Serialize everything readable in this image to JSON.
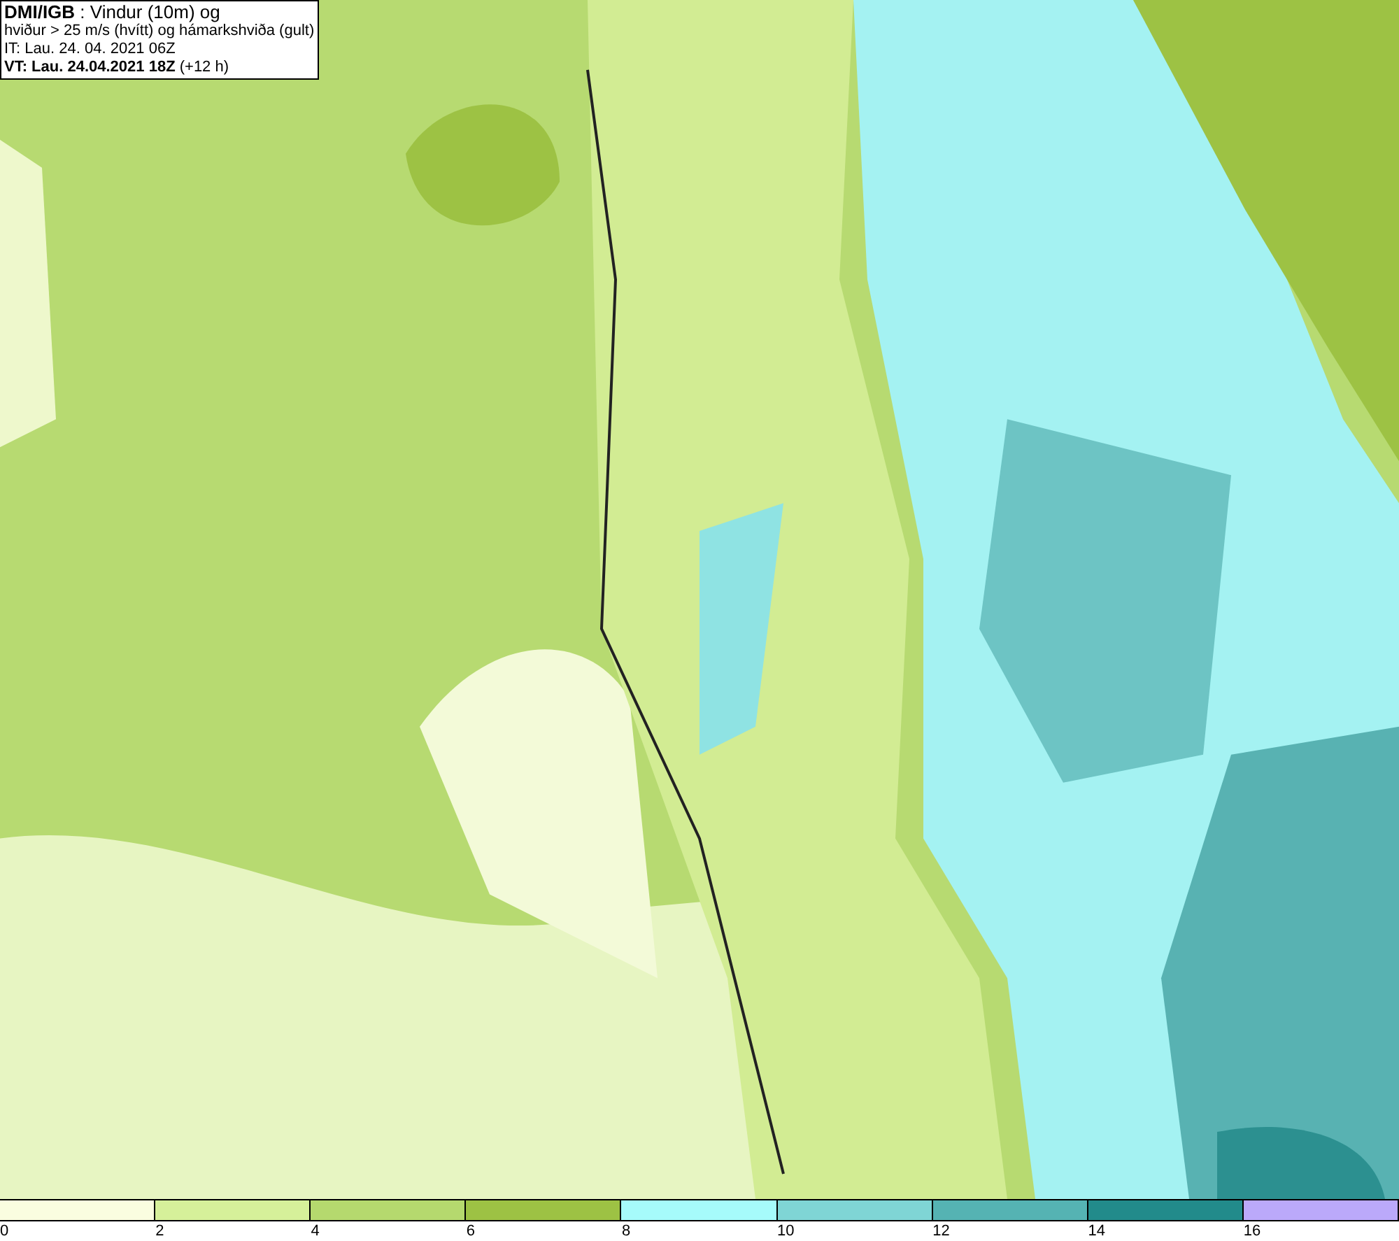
{
  "title_box": {
    "lines": [
      "**DMI/IGB** : Vindur (10m) og",
      "hviður > 25 m/s (hvítt) og hámarkshviða (gult)",
      "IT: Lau. 24. 04. 2021 06Z",
      "**VT: Lau. 24.04.2021 18Z** (+12 h)"
    ]
  },
  "legend": [
    {
      "label": "0",
      "color": "#fafde0"
    },
    {
      "label": "2",
      "color": "#d6f09a"
    },
    {
      "label": "4",
      "color": "#b5d96e"
    },
    {
      "label": "6",
      "color": "#9dc244"
    },
    {
      "label": "8",
      "color": "#a6fbfb"
    },
    {
      "label": "10",
      "color": "#7fd5d5"
    },
    {
      "label": "12",
      "color": "#55b3b3"
    },
    {
      "label": "14",
      "color": "#228b8b"
    },
    {
      "label": "16",
      "color": "#bba9fa"
    }
  ]
}
